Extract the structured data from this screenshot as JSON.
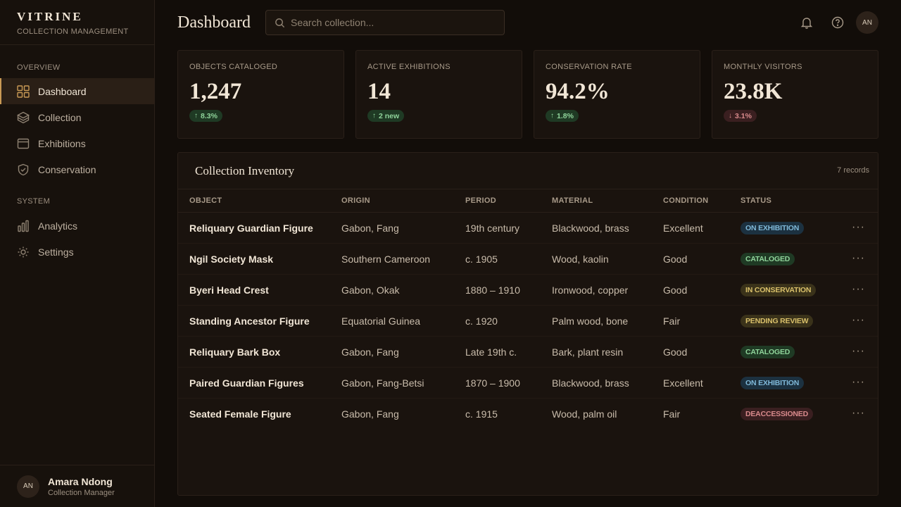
{
  "brand": {
    "name": "VITRINE",
    "subtitle": "COLLECTION MANAGEMENT"
  },
  "sidebar": {
    "sections": [
      {
        "title": "OVERVIEW",
        "items": [
          {
            "label": "Dashboard",
            "icon": "grid-icon",
            "active": true
          },
          {
            "label": "Collection",
            "icon": "layers-icon"
          },
          {
            "label": "Exhibitions",
            "icon": "browser-icon"
          },
          {
            "label": "Conservation",
            "icon": "shield-check-icon"
          }
        ]
      },
      {
        "title": "SYSTEM",
        "items": [
          {
            "label": "Analytics",
            "icon": "bar-chart-icon"
          },
          {
            "label": "Settings",
            "icon": "sun-gear-icon"
          }
        ]
      }
    ],
    "user": {
      "initials": "AN",
      "name": "Amara Ndong",
      "role": "Collection Manager"
    }
  },
  "header": {
    "title": "Dashboard",
    "search_placeholder": "Search collection...",
    "avatar_initials": "AN"
  },
  "stats": [
    {
      "label": "OBJECTS CATALOGED",
      "value": "1,247",
      "badge": "8.3%",
      "trend": "up"
    },
    {
      "label": "ACTIVE EXHIBITIONS",
      "value": "14",
      "badge": "2 new",
      "trend": "up"
    },
    {
      "label": "CONSERVATION RATE",
      "value": "94.2%",
      "badge": "1.8%",
      "trend": "up"
    },
    {
      "label": "MONTHLY VISITORS",
      "value": "23.8K",
      "badge": "3.1%",
      "trend": "down"
    }
  ],
  "inventory": {
    "title": "Collection Inventory",
    "count": "7 records",
    "columns": [
      "OBJECT",
      "ORIGIN",
      "PERIOD",
      "MATERIAL",
      "CONDITION",
      "STATUS"
    ],
    "rows": [
      {
        "object": "Reliquary Guardian Figure",
        "origin": "Gabon, Fang",
        "period": "19th century",
        "material": "Blackwood, brass",
        "condition": "Excellent",
        "status": "ON EXHIBITION"
      },
      {
        "object": "Ngil Society Mask",
        "origin": "Southern Cameroon",
        "period": "c. 1905",
        "material": "Wood, kaolin",
        "condition": "Good",
        "status": "CATALOGED"
      },
      {
        "object": "Byeri Head Crest",
        "origin": "Gabon, Okak",
        "period": "1880 – 1910",
        "material": "Ironwood, copper",
        "condition": "Good",
        "status": "IN CONSERVATION"
      },
      {
        "object": "Standing Ancestor Figure",
        "origin": "Equatorial Guinea",
        "period": "c. 1920",
        "material": "Palm wood, bone",
        "condition": "Fair",
        "status": "PENDING REVIEW"
      },
      {
        "object": "Reliquary Bark Box",
        "origin": "Gabon, Fang",
        "period": "Late 19th c.",
        "material": "Bark, plant resin",
        "condition": "Good",
        "status": "CATALOGED"
      },
      {
        "object": "Paired Guardian Figures",
        "origin": "Gabon, Fang-Betsi",
        "period": "1870 – 1900",
        "material": "Blackwood, brass",
        "condition": "Excellent",
        "status": "ON EXHIBITION"
      },
      {
        "object": "Seated Female Figure",
        "origin": "Gabon, Fang",
        "period": "c. 1915",
        "material": "Wood, palm oil",
        "condition": "Fair",
        "status": "DEACCESSIONED"
      }
    ],
    "status_colors": {
      "ON EXHIBITION": {
        "bg": "#1c3140",
        "fg": "#7fb8d8"
      },
      "CATALOGED": {
        "bg": "#1f3a24",
        "fg": "#8fd39a"
      },
      "IN CONSERVATION": {
        "bg": "#3a321a",
        "fg": "#d9c06a"
      },
      "PENDING REVIEW": {
        "bg": "#3a321a",
        "fg": "#d9c06a"
      },
      "DEACCESSIONED": {
        "bg": "#3a1f20",
        "fg": "#d98a8c"
      }
    }
  },
  "accent_color": "#c99a55"
}
